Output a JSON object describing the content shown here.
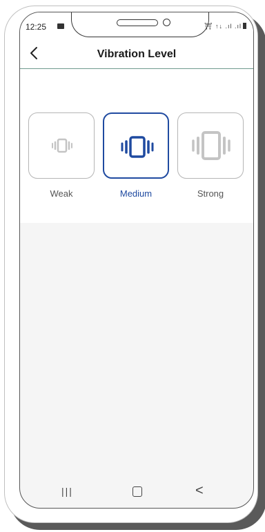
{
  "status_bar": {
    "time": "12:25",
    "icons": "⛩ ↑↓ .ıl .ıl"
  },
  "header": {
    "title": "Vibration Level"
  },
  "options": [
    {
      "label": "Weak",
      "icon": "vibration-icon-weak",
      "selected": false
    },
    {
      "label": "Medium",
      "icon": "vibration-icon-medium",
      "selected": true
    },
    {
      "label": "Strong",
      "icon": "vibration-icon-strong",
      "selected": false
    }
  ],
  "navigation": {
    "recent_symbol": "|||",
    "back_symbol": "<"
  },
  "colors": {
    "accent": "#1f4aa0",
    "inactive_icon": "#c4c4c4",
    "inactive_border": "#b5b5b5",
    "background_lower": "#f5f5f5",
    "header_divider": "#6e9a8e"
  }
}
